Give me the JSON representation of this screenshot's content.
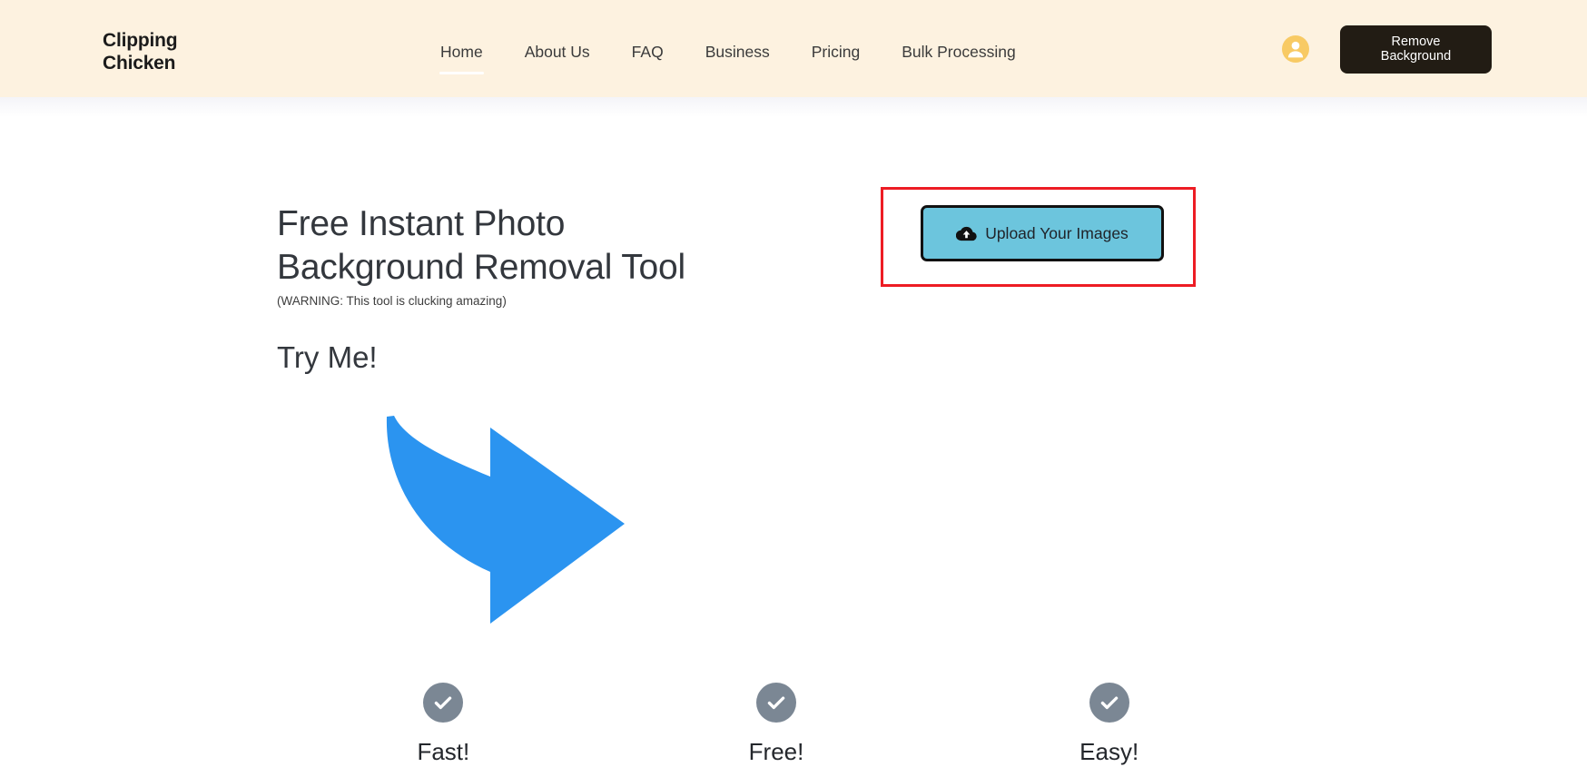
{
  "header": {
    "logo": {
      "line1": "Clipping",
      "line2": "Chicken"
    },
    "nav": [
      {
        "label": "Home",
        "active": true
      },
      {
        "label": "About Us",
        "active": false
      },
      {
        "label": "FAQ",
        "active": false
      },
      {
        "label": "Business",
        "active": false
      },
      {
        "label": "Pricing",
        "active": false
      },
      {
        "label": "Bulk Processing",
        "active": false
      }
    ],
    "avatar_icon": "user-avatar-icon",
    "cta": {
      "line1": "Remove",
      "line2": "Background"
    },
    "background_color": "#fdf2e0",
    "cta_color": "#221c14",
    "avatar_color": "#f8ca64"
  },
  "hero": {
    "title_line1": "Free Instant Photo",
    "title_line2": "Background Removal Tool",
    "subtitle": "(WARNING: This tool is clucking amazing)",
    "try_me": "Try Me!",
    "arrow_icon": "curved-right-arrow-icon",
    "arrow_color": "#2196f3"
  },
  "upload": {
    "button_label": "Upload Your Images",
    "icon": "cloud-upload-icon",
    "button_color": "#6cc5dd",
    "highlight_color": "#ed1c24"
  },
  "features": [
    {
      "label": "Fast!",
      "icon": "check-circle-icon"
    },
    {
      "label": "Free!",
      "icon": "check-circle-icon"
    },
    {
      "label": "Easy!",
      "icon": "check-circle-icon"
    }
  ]
}
